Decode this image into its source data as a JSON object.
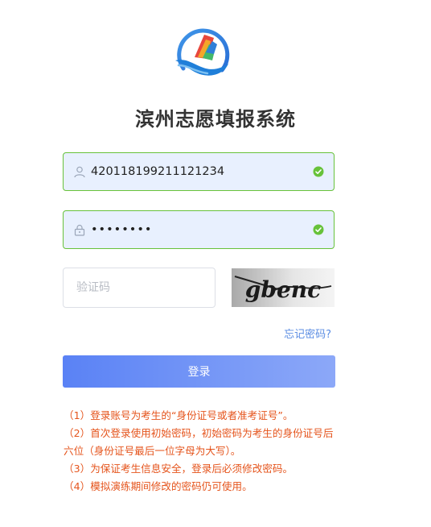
{
  "header": {
    "title": "滨州志愿填报系统"
  },
  "login_form": {
    "account_value": "420118199211121234",
    "password_masked": "••••••••",
    "captcha_placeholder": "验证码",
    "captcha_text": "gbenc",
    "forgot_link": "忘记密码?",
    "submit_label": "登录"
  },
  "notes": [
    "（1）登录账号为考生的“身份证号或者准考证号”。",
    "（2）首次登录使用初始密码，初始密码为考生的身份证号后六位（身份证号最后一位字母为大写）。",
    "（3）为保证考生信息安全，登录后必须修改密码。",
    "（4）模拟演练期间修改的密码仍可使用。"
  ],
  "colors": {
    "accent": "#5b8de3",
    "valid_border": "#67c23a",
    "note_text": "#e5541c",
    "button_start": "#5a82f5",
    "button_end": "#8ca8f8"
  }
}
